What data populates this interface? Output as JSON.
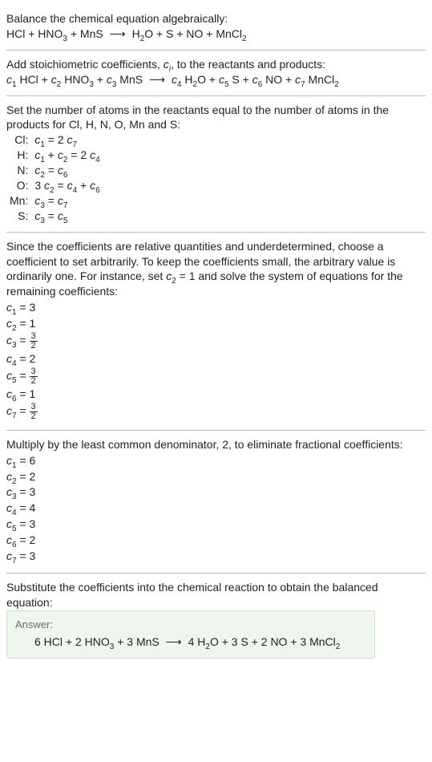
{
  "intro": {
    "line1": "Balance the chemical equation algebraically:",
    "eq_left": "HCl + HNO",
    "eq_left2": " + MnS",
    "eq_right": "H",
    "eq_right2": "O + S + NO + MnCl"
  },
  "add_stoich": {
    "line1_a": "Add stoichiometric coefficients, ",
    "line1_b": ", to the reactants and products:"
  },
  "set_atoms": {
    "line1": "Set the number of atoms in the reactants equal to the number of atoms in the products for Cl, H, N, O, Mn and S:"
  },
  "atoms": [
    {
      "el": "Cl:",
      "lhs": "c",
      "l_sub": "1",
      "lop": " = 2 ",
      "r": "c",
      "r_sub": "7",
      "tail": ""
    },
    {
      "el": "H:",
      "lhs": "c",
      "l_sub": "1",
      "lop": " + ",
      "m": "c",
      "m_sub": "2",
      "mop": " = 2 ",
      "r": "c",
      "r_sub": "4",
      "tail": ""
    },
    {
      "el": "N:",
      "lhs": "c",
      "l_sub": "2",
      "lop": " = ",
      "r": "c",
      "r_sub": "6",
      "tail": ""
    },
    {
      "el": "O:",
      "pre": "3 ",
      "lhs": "c",
      "l_sub": "2",
      "lop": " = ",
      "m": "c",
      "m_sub": "4",
      "mop": " + ",
      "r": "c",
      "r_sub": "6",
      "tail": ""
    },
    {
      "el": "Mn:",
      "lhs": "c",
      "l_sub": "3",
      "lop": " = ",
      "r": "c",
      "r_sub": "7",
      "tail": ""
    },
    {
      "el": "S:",
      "lhs": "c",
      "l_sub": "3",
      "lop": " = ",
      "r": "c",
      "r_sub": "5",
      "tail": ""
    }
  ],
  "underdet": {
    "t1": "Since the coefficients are relative quantities and underdetermined, choose a coefficient to set arbitrarily. To keep the coefficients small, the arbitrary value is ordinarily one. For instance, set ",
    "t2": " = 1 and solve the system of equations for the remaining coefficients:"
  },
  "sol1": [
    {
      "sub": "1",
      "val": "3",
      "is_frac": false
    },
    {
      "sub": "2",
      "val": "1",
      "is_frac": false
    },
    {
      "sub": "3",
      "top": "3",
      "bot": "2",
      "is_frac": true
    },
    {
      "sub": "4",
      "val": "2",
      "is_frac": false
    },
    {
      "sub": "5",
      "top": "3",
      "bot": "2",
      "is_frac": true
    },
    {
      "sub": "6",
      "val": "1",
      "is_frac": false
    },
    {
      "sub": "7",
      "top": "3",
      "bot": "2",
      "is_frac": true
    }
  ],
  "lcd": {
    "text": "Multiply by the least common denominator, 2, to eliminate fractional coefficients:"
  },
  "sol2": [
    {
      "sub": "1",
      "val": "6"
    },
    {
      "sub": "2",
      "val": "2"
    },
    {
      "sub": "3",
      "val": "3"
    },
    {
      "sub": "4",
      "val": "4"
    },
    {
      "sub": "5",
      "val": "3"
    },
    {
      "sub": "6",
      "val": "2"
    },
    {
      "sub": "7",
      "val": "3"
    }
  ],
  "subst": {
    "text": "Substitute the coefficients into the chemical reaction to obtain the balanced equation:"
  },
  "answer": {
    "label": "Answer:",
    "lhs": "6 HCl + 2 HNO",
    "lhs2": " + 3 MnS",
    "rhs_a": "4 H",
    "rhs_b": "O + 3 S + 2 NO + 3 MnCl"
  },
  "subs": {
    "three": "3",
    "two": "2",
    "i": "i"
  }
}
